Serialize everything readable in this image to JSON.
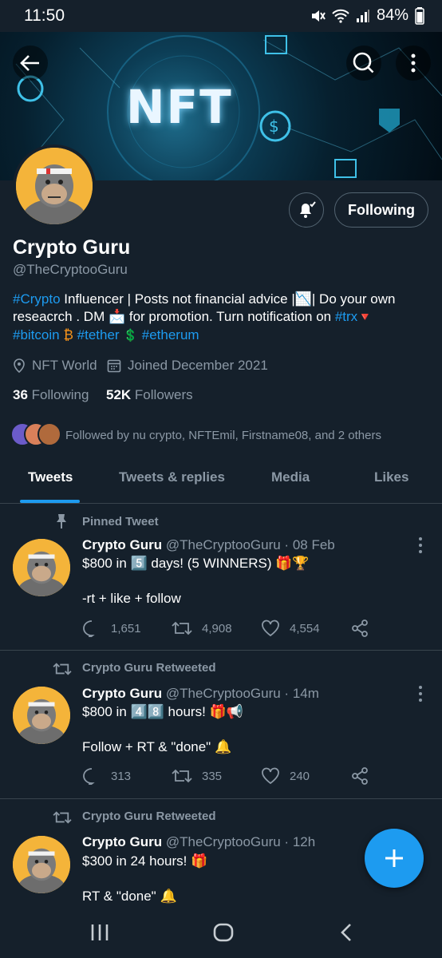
{
  "status_bar": {
    "time": "11:50",
    "battery": "84%"
  },
  "banner": {
    "text": "NFT"
  },
  "profile": {
    "name": "Crypto Guru",
    "handle": "@TheCryptooGuru",
    "following_button": "Following",
    "bio": {
      "tag_crypto": "#Crypto",
      "line1": " Influencer | Posts not financial advice |📉| Do your own",
      "line2a": "reseacrch . DM 📩 for promotion. Turn notification on ",
      "tag_trx": "#trx",
      "trx_emoji": "🔻",
      "tag_bitcoin": "#bitcoin",
      "btc_emoji": "₿",
      "tag_tether": "#tether",
      "tether_emoji": "💲",
      "tag_etherum": "#etherum"
    },
    "location": "NFT World",
    "joined": "Joined December 2021",
    "following_count": "36",
    "following_label": "Following",
    "followers_count": "52K",
    "followers_label": "Followers",
    "followed_by": "Followed by nu crypto, NFTEmil, Firstname08, and 2 others"
  },
  "tabs": [
    "Tweets",
    "Tweets & replies",
    "Media",
    "Likes"
  ],
  "tweets": [
    {
      "context": "Pinned Tweet",
      "name": "Crypto Guru",
      "meta": "@TheCryptooGuru · 08 Feb",
      "line1": "$800 in 5️⃣ days! (5 WINNERS) 🎁🏆",
      "line2": "-rt + like + follow",
      "replies": "1,651",
      "retweets": "4,908",
      "likes": "4,554"
    },
    {
      "context": "Crypto Guru Retweeted",
      "name": "Crypto Guru",
      "meta": "@TheCryptooGuru · 14m",
      "line1": "$800 in 4️⃣8️⃣ hours! 🎁📢",
      "line2": "Follow + RT & \"done\" 🔔",
      "replies": "313",
      "retweets": "335",
      "likes": "240"
    },
    {
      "context": "Crypto Guru Retweeted",
      "name": "Crypto Guru",
      "meta": "@TheCryptooGuru · 12h",
      "line1": "$300 in 24 hours! 🎁",
      "line2": "RT & \"done\" 🔔"
    }
  ],
  "colors": {
    "background": "#15202b",
    "accent": "#1d9bf0",
    "muted": "#8b98a5",
    "divider": "#38444d"
  }
}
